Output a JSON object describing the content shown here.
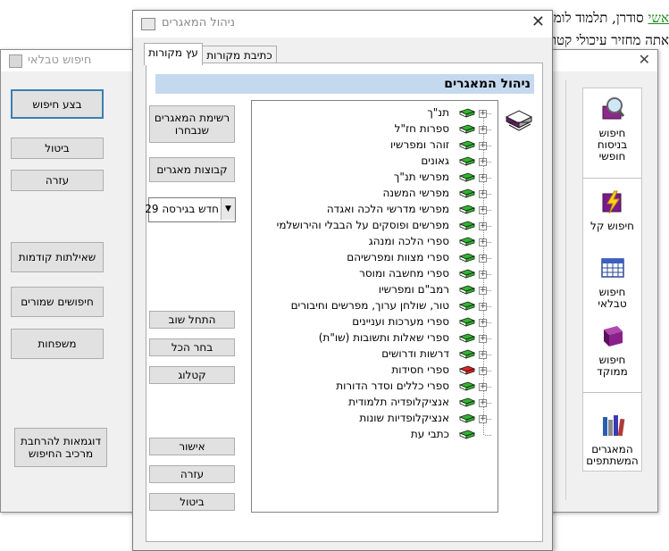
{
  "background_doc": {
    "line1_prefix": "אשי",
    "line1_rest": " סודרן, תלמוד לומר",
    "line2": "אתה מחזיר עיכולי קטור"
  },
  "back_dialog": {
    "title": "חיפוש טבלאי",
    "buttons": {
      "search": "בצע חיפוש",
      "cancel": "ביטול",
      "help": "עזרה",
      "previous_queries": "שאילתות קודמות",
      "saved_searches": "חיפושים שמורים",
      "families": "משפחות",
      "expansion_examples": "דוגמאות להרחבת מרכיב החיפוש"
    },
    "sidebar": {
      "items": [
        {
          "label": "חיפוש בניסוח חופשי",
          "icon": "magnifier-book-icon"
        },
        {
          "label": "חיפוש קל",
          "icon": "lightning-book-icon"
        },
        {
          "label": "חיפוש טבלאי",
          "icon": "table-grid-icon"
        },
        {
          "label": "חיפוש ממוקד",
          "icon": "purple-book-icon"
        },
        {
          "label": "המאגרים המשתתפים",
          "icon": "books-shelf-icon"
        }
      ]
    }
  },
  "front_dialog": {
    "title": "ניהול המאגרים",
    "tabs": [
      {
        "label": "עץ מקורות",
        "active": true
      },
      {
        "label": "כתיבת מקורות",
        "active": false
      }
    ],
    "header": "ניהול המאגרים",
    "buttons": {
      "selected_list": "רשימת המאגרים שנבחרו",
      "groups": "קבוצות מאגרים",
      "reset": "התחל שוב",
      "select_all": "בחר הכל",
      "catalog": "קטלוג",
      "ok": "אישור",
      "help": "עזרה",
      "cancel": "ביטול"
    },
    "version_select": {
      "value": "חדש בגירסה 29"
    },
    "tree": [
      {
        "label": "תנ\"ך",
        "color": "#2fb52f",
        "expandable": true
      },
      {
        "label": "ספרות חז\"ל",
        "color": "#2fb52f",
        "expandable": true
      },
      {
        "label": "זוהר ומפרשיו",
        "color": "#2fb52f",
        "expandable": true
      },
      {
        "label": "גאונים",
        "color": "#2fb52f",
        "expandable": true
      },
      {
        "label": "מפרשי תנ\"ך",
        "color": "#2fb52f",
        "expandable": true
      },
      {
        "label": "מפרשי המשנה",
        "color": "#2fb52f",
        "expandable": true
      },
      {
        "label": "מפרשי מדרשי הלכה ואגדה",
        "color": "#2fb52f",
        "expandable": true
      },
      {
        "label": "מפרשים ופוסקים על הבבלי והירושלמי",
        "color": "#2fb52f",
        "expandable": true
      },
      {
        "label": "ספרי הלכה ומנהג",
        "color": "#2fb52f",
        "expandable": true
      },
      {
        "label": "ספרי מצוות ומפרשיהם",
        "color": "#2fb52f",
        "expandable": true
      },
      {
        "label": "ספרי מחשבה ומוסר",
        "color": "#2fb52f",
        "expandable": true
      },
      {
        "label": "רמב\"ם ומפרשיו",
        "color": "#2fb52f",
        "expandable": true
      },
      {
        "label": "טור, שולחן ערוך, מפרשים וחיבורים",
        "color": "#2fb52f",
        "expandable": true
      },
      {
        "label": "ספרי מערכות ועניינים",
        "color": "#2fb52f",
        "expandable": true
      },
      {
        "label": "ספרי שאלות ותשובות (שו\"ת)",
        "color": "#2fb52f",
        "expandable": true
      },
      {
        "label": "דרשות ודרושים",
        "color": "#2fb52f",
        "expandable": true
      },
      {
        "label": "ספרי חסידות",
        "color": "#e02020",
        "expandable": true
      },
      {
        "label": "ספרי כללים וסדר הדורות",
        "color": "#2fb52f",
        "expandable": true
      },
      {
        "label": "אנציקלופדיה תלמודית",
        "color": "#2fb52f",
        "expandable": true
      },
      {
        "label": "אנציקלופדיות שונות",
        "color": "#2fb52f",
        "expandable": true
      },
      {
        "label": "כתבי עת",
        "color": "#2fb52f",
        "expandable": false
      }
    ]
  }
}
